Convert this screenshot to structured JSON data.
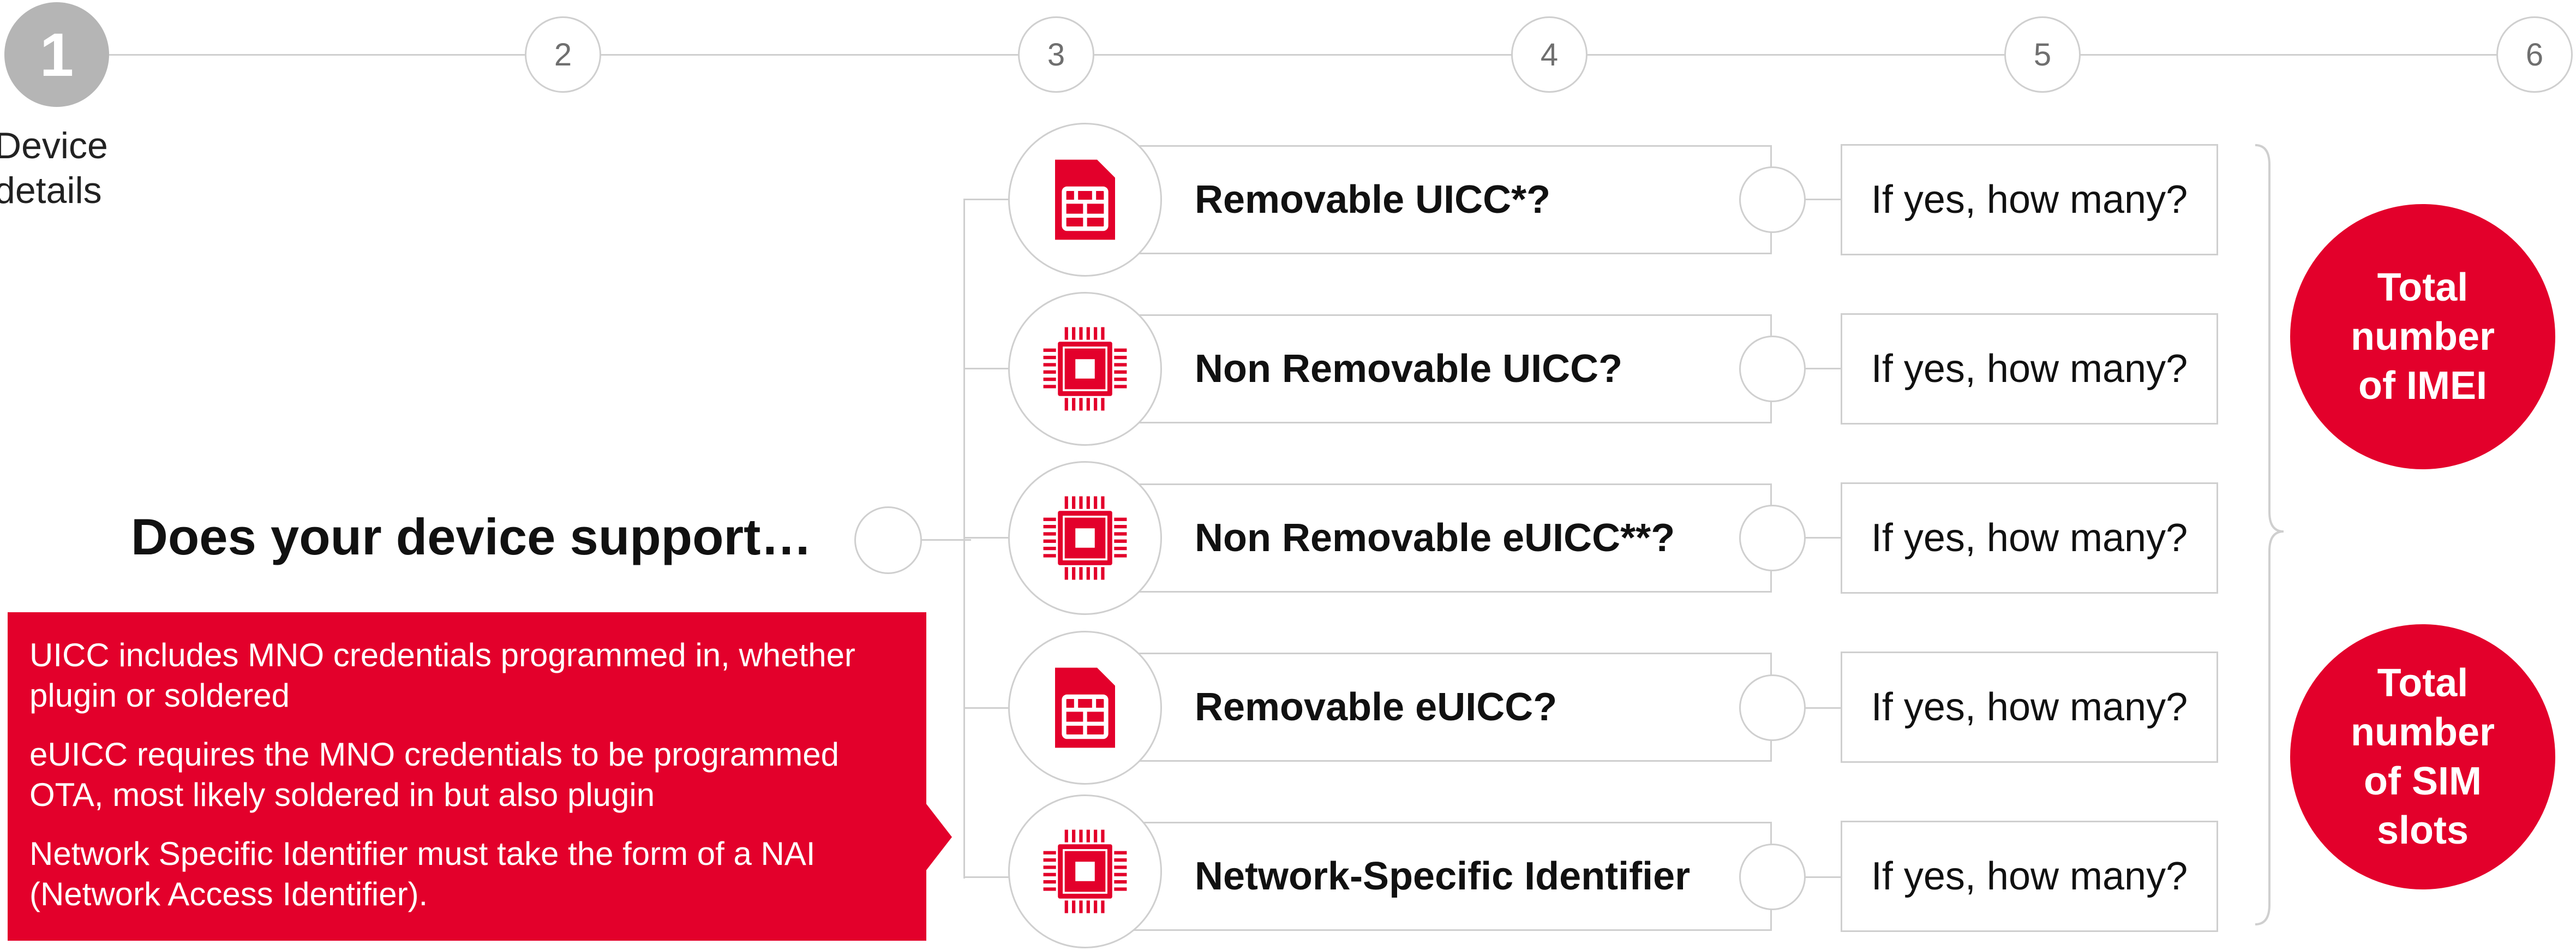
{
  "steps": [
    {
      "number": "1",
      "label": "Device details",
      "active": true
    },
    {
      "number": "2"
    },
    {
      "number": "3"
    },
    {
      "number": "4"
    },
    {
      "number": "5"
    },
    {
      "number": "6"
    }
  ],
  "question": "Does your device support…",
  "notes": [
    "UICC includes MNO credentials programmed in, whether plugin or soldered",
    "eUICC requires the MNO credentials to be programmed OTA, most likely soldered in but also plugin",
    "Network Specific Identifier must take the form of a NAI (Network Access Identifier)."
  ],
  "options": [
    {
      "label": "Removable UICC*?",
      "icon": "sim-card-icon",
      "answer": "If yes, how many?"
    },
    {
      "label": "Non Removable UICC?",
      "icon": "chip-icon",
      "answer": "If yes, how many?"
    },
    {
      "label": "Non Removable eUICC**?",
      "icon": "chip-icon",
      "answer": "If yes, how many?"
    },
    {
      "label": "Removable eUICC?",
      "icon": "sim-card-icon",
      "answer": "If yes, how many?"
    },
    {
      "label": "Network-Specific Identifier",
      "icon": "chip-icon",
      "answer": "If yes, how many?"
    }
  ],
  "totals": {
    "imei": "Total\nnumber\nof IMEI",
    "sim_slots": "Total\nnumber\nof SIM\nslots"
  },
  "colors": {
    "accent": "#e3002b",
    "line": "#cfcfcf",
    "active_step": "#b5b5b5"
  }
}
